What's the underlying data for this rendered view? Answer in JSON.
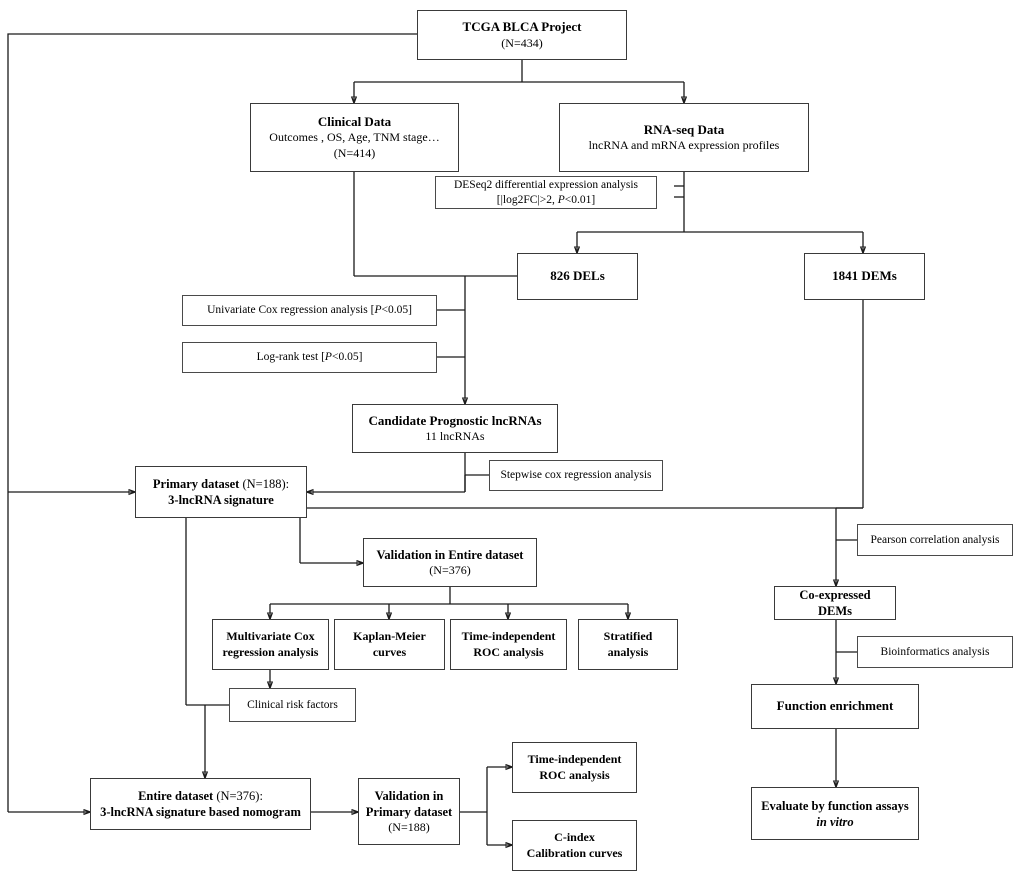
{
  "diagram": {
    "title": "TCGA BLCA lncRNA prognostic signature analysis workflow",
    "type": "flowchart",
    "accent_color": "#1a1a1a",
    "background": "#ffffff"
  },
  "nodes": {
    "tcga": {
      "line1": "TCGA BLCA Project",
      "line2": "(N=434)"
    },
    "clinical": {
      "line1": "Clinical Data",
      "line2": "Outcomes , OS, Age, TNM stage…",
      "line3": "(N=414)"
    },
    "rnaseq": {
      "line1": "RNA-seq Data",
      "line2": "lncRNA and mRNA expression profiles"
    },
    "deseq2": {
      "line1": "DESeq2 differential expression analysis",
      "line2a": "[|log2FC|>2, ",
      "line2b": "P",
      "line2c": "<0.01]"
    },
    "dels": {
      "line1": "826 DELs"
    },
    "dems": {
      "line1": "1841 DEMs"
    },
    "univariate": {
      "line1a": "Univariate Cox regression analysis [",
      "line1b": "P",
      "line1c": "<0.05]"
    },
    "logrank": {
      "line1a": "Log-rank test [",
      "line1b": "P",
      "line1c": "<0.05]"
    },
    "candidate": {
      "line1": "Candidate Prognostic lncRNAs",
      "line2": "11 lncRNAs"
    },
    "stepwise": {
      "line1": "Stepwise cox regression analysis"
    },
    "primary": {
      "line1a": "Primary dataset",
      "line1b": " (N=188):",
      "line2": "3-lncRNA signature"
    },
    "validation_entire": {
      "line1": "Validation in Entire dataset",
      "line2": "(N=376)"
    },
    "multivariate": {
      "line1": "Multivariate Cox",
      "line2": "regression analysis"
    },
    "km": {
      "line1": "Kaplan-Meier",
      "line2": "curves"
    },
    "roc1": {
      "line1": "Time-independent",
      "line2": "ROC analysis"
    },
    "stratified": {
      "line1": "Stratified",
      "line2": "analysis"
    },
    "clinical_risk": {
      "line1": "Clinical risk factors"
    },
    "entire": {
      "line1a": "Entire dataset",
      "line1b": " (N=376):",
      "line2": "3-lncRNA signature based nomogram"
    },
    "validation_primary": {
      "line1": "Validation in",
      "line2": "Primary dataset",
      "line3": "(N=188)"
    },
    "roc2": {
      "line1": "Time-independent",
      "line2": "ROC analysis"
    },
    "cindex": {
      "line1": "C-index",
      "line2": "Calibration curves"
    },
    "pearson": {
      "line1": "Pearson correlation analysis"
    },
    "coexpressed": {
      "line1": "Co-expressed",
      "line2": "DEMs"
    },
    "bioinformatics": {
      "line1": "Bioinformatics analysis"
    },
    "function_enrichment": {
      "line1": "Function enrichment"
    },
    "evaluate": {
      "line1": "Evaluate by function assays",
      "line2": "in vitro"
    }
  }
}
